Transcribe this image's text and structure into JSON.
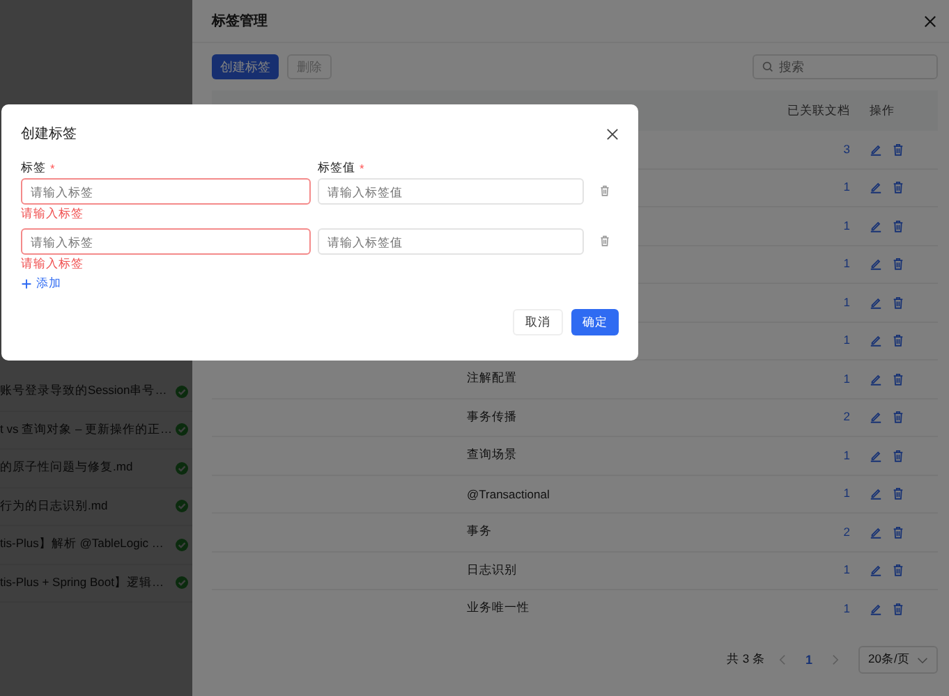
{
  "background_list": {
    "items": [
      {
        "title": "账号登录导致的Session串号…"
      },
      {
        "title": "t vs 查询对象 – 更新操作的正…"
      },
      {
        "title": "的原子性问题与修复.md"
      },
      {
        "title": "行为的日志识别.md"
      },
      {
        "title": "tis-Plus】解析 @TableLogic …"
      },
      {
        "title": "tis-Plus + Spring Boot】逻辑…"
      }
    ]
  },
  "drawer": {
    "title": "标签管理",
    "toolbar": {
      "buttons": [
        {
          "label": "创建标签",
          "kind": "primary",
          "disabled": false
        },
        {
          "label": "删除",
          "kind": "default",
          "disabled": true
        }
      ],
      "search": {
        "placeholder": "搜索"
      }
    },
    "table": {
      "columns": [
        "已关联文档",
        "操作"
      ],
      "rows": [
        {
          "count": "3"
        },
        {
          "count": "1"
        },
        {
          "count": "1"
        },
        {
          "count": "1"
        },
        {
          "count": "1"
        },
        {
          "count": "1"
        },
        {
          "tag": "注解配置",
          "count": "1"
        },
        {
          "tag": "事务传播",
          "count": "2"
        },
        {
          "tag": "查询场景",
          "count": "1"
        },
        {
          "tag": "@Transactional",
          "count": "1"
        },
        {
          "tag": "事务",
          "count": "2"
        },
        {
          "tag": "日志识别",
          "count": "1"
        },
        {
          "tag": "业务唯一性",
          "count": "1"
        }
      ]
    },
    "pagination": {
      "total": "共 3 条",
      "pages": [
        {
          "label": "1",
          "selected": true
        }
      ],
      "prev_disabled": true,
      "next_disabled": true,
      "page_size": "20条/页"
    }
  },
  "modal": {
    "title": "创建标签",
    "fields": [
      {
        "label": "标签",
        "required_mark": "*"
      },
      {
        "label": "标签值",
        "required_mark": "*"
      }
    ],
    "rows": [
      {
        "tag_placeholder": "请输入标签",
        "value_placeholder": "请输入标签值",
        "error": "请输入标签"
      },
      {
        "tag_placeholder": "请输入标签",
        "value_placeholder": "请输入标签值",
        "error": "请输入标签"
      }
    ],
    "add_label": "添加",
    "buttons": [
      {
        "label": "取消",
        "kind": "default"
      },
      {
        "label": "确定",
        "kind": "primary"
      }
    ]
  }
}
